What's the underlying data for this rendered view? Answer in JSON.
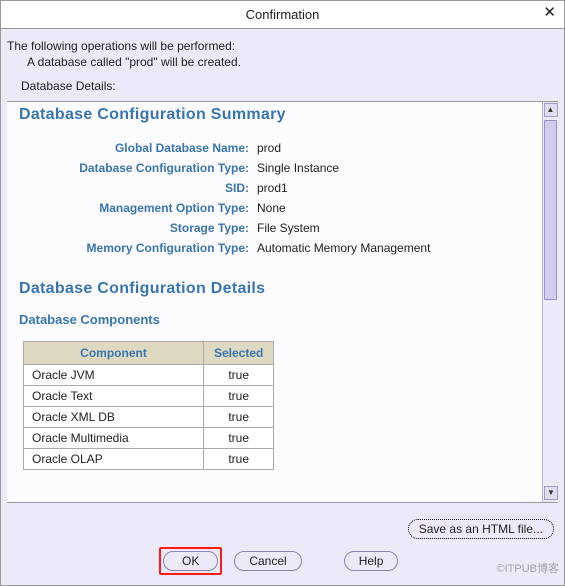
{
  "title": "Confirmation",
  "intro_line1": "The following operations will be performed:",
  "intro_line2": "A database called \"prod\" will be created.",
  "details_caption": "Database Details:",
  "summary": {
    "heading": "Database Configuration Summary",
    "rows": [
      {
        "label": "Global Database Name:",
        "value": "prod"
      },
      {
        "label": "Database Configuration Type:",
        "value": "Single Instance"
      },
      {
        "label": "SID:",
        "value": "prod1"
      },
      {
        "label": "Management Option Type:",
        "value": "None"
      },
      {
        "label": "Storage Type:",
        "value": "File System"
      },
      {
        "label": "Memory Configuration Type:",
        "value": "Automatic Memory Management"
      }
    ]
  },
  "details_heading": "Database Configuration Details",
  "components": {
    "heading": "Database Components",
    "col_component": "Component",
    "col_selected": "Selected",
    "rows": [
      {
        "name": "Oracle JVM",
        "selected": "true"
      },
      {
        "name": "Oracle Text",
        "selected": "true"
      },
      {
        "name": "Oracle XML DB",
        "selected": "true"
      },
      {
        "name": "Oracle Multimedia",
        "selected": "true"
      },
      {
        "name": "Oracle OLAP",
        "selected": "true"
      }
    ]
  },
  "buttons": {
    "save_html": "Save as an HTML file...",
    "ok": "OK",
    "cancel": "Cancel",
    "help": "Help"
  },
  "watermark": "©ITPUB博客"
}
